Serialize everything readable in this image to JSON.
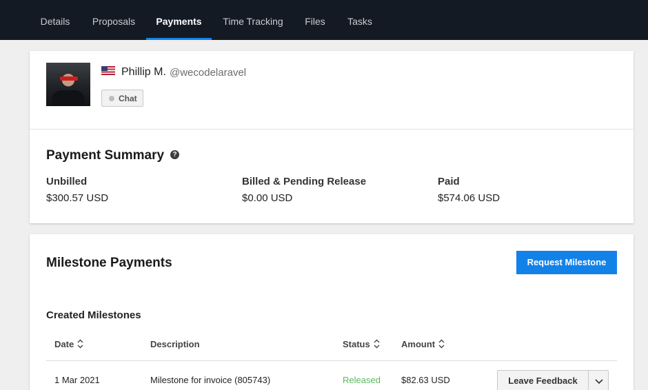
{
  "nav": {
    "tabs": [
      {
        "label": "Details"
      },
      {
        "label": "Proposals"
      },
      {
        "label": "Payments",
        "active": true
      },
      {
        "label": "Time Tracking"
      },
      {
        "label": "Files"
      },
      {
        "label": "Tasks"
      }
    ]
  },
  "profile": {
    "name": "Phillip M.",
    "handle": "@wecodelaravel",
    "flag": "us-flag-icon",
    "chat_label": "Chat"
  },
  "summary": {
    "title": "Payment Summary",
    "help_icon": "?",
    "items": [
      {
        "label": "Unbilled",
        "value": "$300.57 USD"
      },
      {
        "label": "Billed & Pending Release",
        "value": "$0.00 USD"
      },
      {
        "label": "Paid",
        "value": "$574.06 USD"
      }
    ]
  },
  "milestones": {
    "title": "Milestone Payments",
    "request_label": "Request Milestone",
    "created_title": "Created Milestones",
    "columns": [
      "Date",
      "Description",
      "Status",
      "Amount"
    ],
    "rows": [
      {
        "date": "1 Mar 2021",
        "description": "Milestone for invoice (805743)",
        "status": "Released",
        "amount": "$82.63 USD",
        "action": "Leave Feedback"
      }
    ]
  },
  "colors": {
    "nav_bg": "#141a24",
    "accent": "#1382e8",
    "released": "#5cb85c"
  }
}
